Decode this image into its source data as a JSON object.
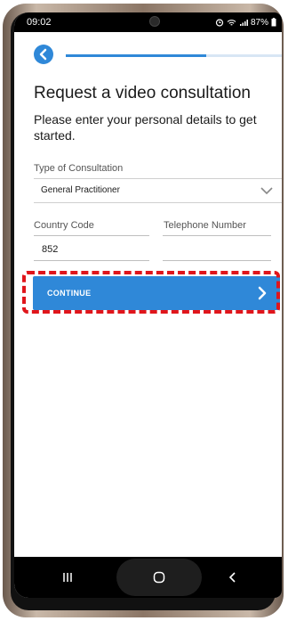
{
  "status_bar": {
    "time": "09:02",
    "battery": "87%"
  },
  "header": {
    "back_icon": "chevron-left-icon",
    "progress": 0.65,
    "accent_color": "#2f88d8"
  },
  "page": {
    "title": "Request a video consultation",
    "subtitle": "Please enter your personal details to get started."
  },
  "form": {
    "consultation_type": {
      "label": "Type of Consultation",
      "value": "General Practitioner"
    },
    "country_code": {
      "label": "Country Code",
      "value": "852"
    },
    "telephone": {
      "label": "Telephone Number",
      "value": ""
    }
  },
  "actions": {
    "continue_label": "CONTINUE",
    "highlight_color": "#e0151b"
  },
  "nav_bar": {
    "items": [
      "recent-apps-icon",
      "home-icon",
      "back-icon"
    ]
  }
}
